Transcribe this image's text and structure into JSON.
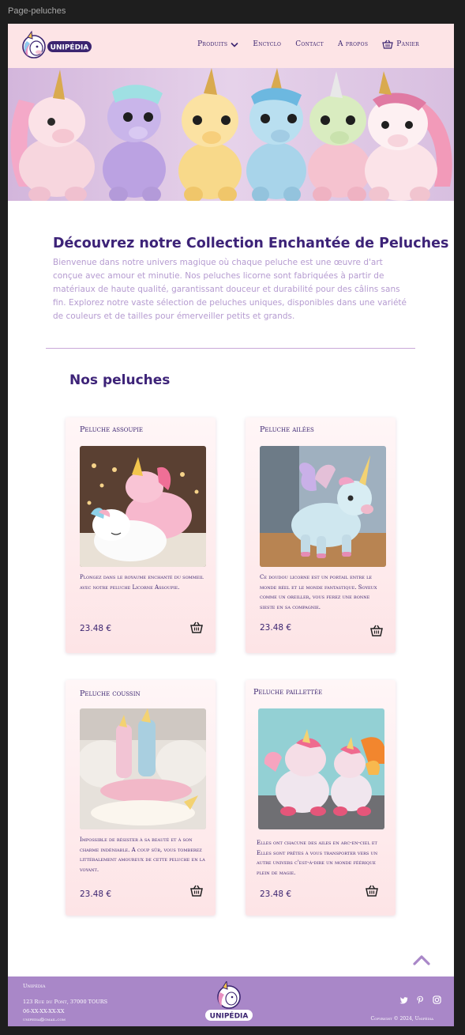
{
  "frame_label": "Page-peluches",
  "brand": {
    "name": "UNIPÉDIA"
  },
  "nav": {
    "produits": "Produits",
    "encyclo": "Encyclo",
    "contact": "Contact",
    "apropos": "A propos",
    "panier": "Panier"
  },
  "intro": {
    "title": "Découvrez notre Collection Enchantée de Peluches Licorne",
    "text": "Bienvenue dans notre univers magique où chaque peluche est une œuvre  d'art conçue avec amour et minutie. Nos peluches licorne sont fabriquées  à partir de matériaux de haute qualité, garantissant douceur et  durabilité pour des câlins sans fin. Explorez notre vaste sélection de  peluches uniques, disponibles dans une variété de couleurs et de tailles pour émerveiller petits et grands."
  },
  "section_title": "Nos peluches",
  "products": [
    {
      "title": "Peluche assoupie",
      "description": "Plongez dans le royaume enchanté du sommeil avec notre peluche Licorne Assoupie.",
      "price": "23.48 €"
    },
    {
      "title": "Peluche ailées",
      "description": "Ce doudou licorne est un portail entre le monde réel et  le monde fantastique. Soyeux comme un oreiller, vous ferez une bonne  sieste en sa compagnie.",
      "price": "23.48 €"
    },
    {
      "title": "Peluche coussin",
      "description": "Impossible de résister à sa beauté et à son charme indéniable. A coup  sûr, vous tomberez littéralement amoureux de cette peluche en la voyant.",
      "price": "23.48 €"
    },
    {
      "title": "Peluche paillettée",
      "description": "Elles ont chacune des ailes en arc-en-ciel et Elles sont prêtes à vous transporter vers un autre  univers c'est-à-dire un monde féérique plein de magie.",
      "price": "23.48 €"
    }
  ],
  "footer": {
    "name": "Unipédia",
    "address": "123 Rue du Pont, 37000 TOURS",
    "phone": "06-XX-XX-XX-XX",
    "email": "unipedia@gmail.com",
    "copyright": "Copyright © 2024, Unipédia"
  },
  "colors": {
    "header_bg": "#fde4e6",
    "accent_purple": "#3b2470",
    "footer_bg": "#a987c8",
    "intro_text": "#b59bd0"
  },
  "icons": [
    "unicorn-logo-icon",
    "chevron-down-icon",
    "basket-icon",
    "arrow-up-icon",
    "twitter-icon",
    "pinterest-icon",
    "instagram-icon"
  ]
}
